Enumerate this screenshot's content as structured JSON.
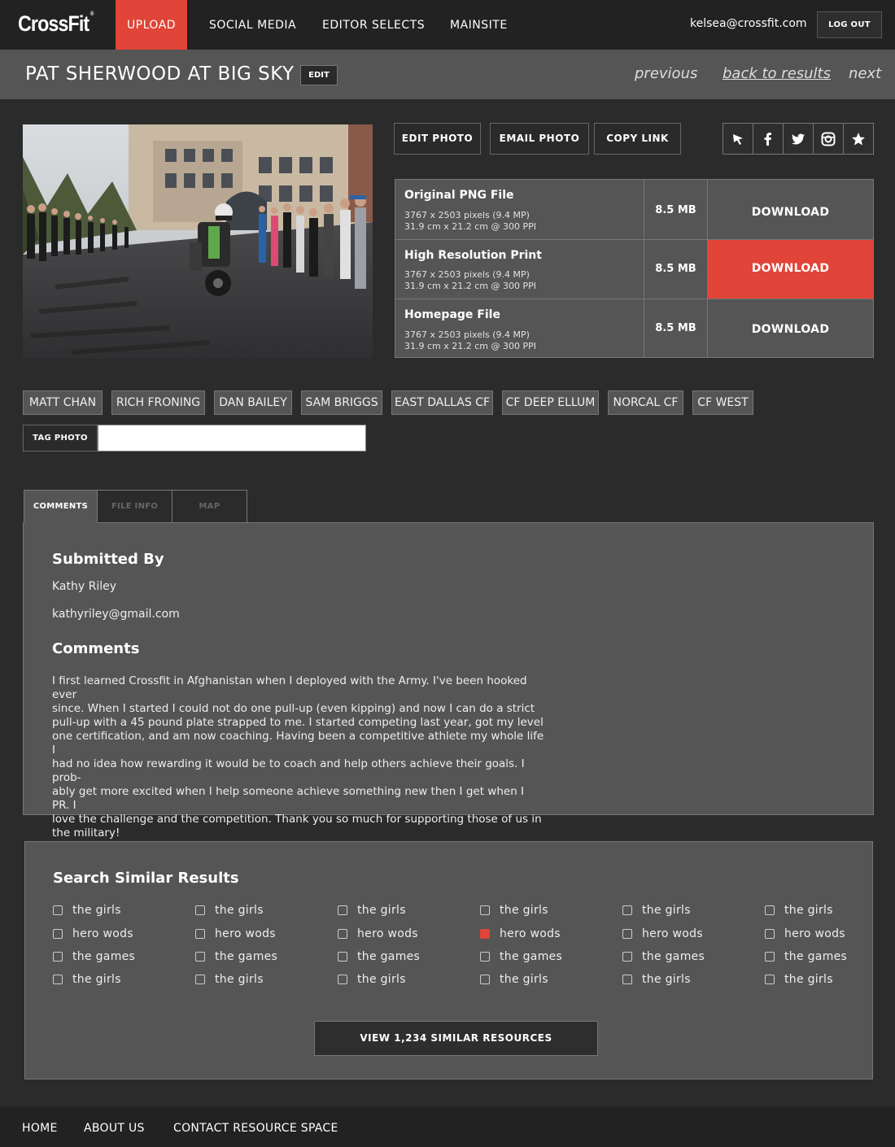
{
  "brand": {
    "logo_text": "CrossFit",
    "logo_mark": "®",
    "accent_color": "#e14438"
  },
  "nav": {
    "items": [
      {
        "label": "UPLOAD"
      },
      {
        "label": "SOCIAL MEDIA"
      },
      {
        "label": "EDITOR SELECTS"
      },
      {
        "label": "MAINSITE"
      }
    ],
    "user_email": "kelsea@crossfit.com",
    "logout_label": "LOG OUT"
  },
  "title_bar": {
    "title": "PAT SHERWOOD AT BIG SKY",
    "edit_label": "EDIT",
    "previous_label": "previous",
    "back_label": "back to results",
    "next_label": "next"
  },
  "actions": {
    "edit_photo": "EDIT PHOTO",
    "email_photo": "EMAIL PHOTO",
    "copy_link": "COPY LINK"
  },
  "share_icons": [
    "cursor-icon",
    "facebook-icon",
    "twitter-icon",
    "instagram-icon",
    "star-icon"
  ],
  "downloads": [
    {
      "name": "Original PNG File",
      "dims": "3767 x 2503 pixels (9.4 MP)",
      "print": "31.9 cm x 21.2 cm @ 300 PPI",
      "size": "8.5 MB",
      "button": "DOWNLOAD"
    },
    {
      "name": "High Resolution Print",
      "dims": "3767 x 2503 pixels (9.4 MP)",
      "print": "31.9 cm x 21.2 cm @ 300 PPI",
      "size": "8.5 MB",
      "button": "DOWNLOAD"
    },
    {
      "name": "Homepage File",
      "dims": "3767 x 2503 pixels (9.4 MP)",
      "print": "31.9 cm x 21.2 cm @ 300 PPI",
      "size": "8.5 MB",
      "button": "DOWNLOAD"
    }
  ],
  "tags": [
    "MATT CHAN",
    "RICH FRONING",
    "DAN BAILEY",
    "SAM BRIGGS",
    "EAST DALLAS CF",
    "CF DEEP ELLUM",
    "NORCAL CF",
    "CF WEST"
  ],
  "tag_photo": {
    "button": "TAG PHOTO",
    "input_value": ""
  },
  "tabs": [
    {
      "label": "COMMENTS"
    },
    {
      "label": "FILE INFO"
    },
    {
      "label": "MAP"
    }
  ],
  "comments_panel": {
    "submitted_heading": "Submitted By",
    "submitter_name": "Kathy Riley",
    "submitter_email": "kathyriley@gmail.com",
    "comments_heading": "Comments",
    "comment_lines": [
      "I first learned Crossfit in Afghanistan when I deployed with the Army.  I've been hooked ever",
      "since.  When I started I could not do one pull-up (even kipping) and now I can do a strict",
      "pull-up with a 45 pound plate strapped to me.  I started competing last year, got my level",
      "one certification, and am now coaching.  Having been a competitive athlete my whole life I",
      "had no idea how rewarding it would be to coach and help others achieve their goals.  I prob-",
      "ably get more excited when I help someone achieve something new then I get when I PR.  I",
      "love the challenge and the competition.  Thank you so much for supporting those of us in",
      "the military!"
    ]
  },
  "similar": {
    "title": "Search Similar Results",
    "columns": [
      [
        {
          "label": "the girls",
          "checked": false
        },
        {
          "label": "hero wods",
          "checked": false
        },
        {
          "label": "the games",
          "checked": false
        },
        {
          "label": "the girls",
          "checked": false
        }
      ],
      [
        {
          "label": "the girls",
          "checked": false
        },
        {
          "label": "hero wods",
          "checked": false
        },
        {
          "label": "the games",
          "checked": false
        },
        {
          "label": "the girls",
          "checked": false
        }
      ],
      [
        {
          "label": "the girls",
          "checked": false
        },
        {
          "label": "hero wods",
          "checked": false
        },
        {
          "label": "the games",
          "checked": false
        },
        {
          "label": "the girls",
          "checked": false
        }
      ],
      [
        {
          "label": "the girls",
          "checked": false
        },
        {
          "label": "hero wods",
          "checked": true
        },
        {
          "label": "the games",
          "checked": false
        },
        {
          "label": "the girls",
          "checked": false
        }
      ],
      [
        {
          "label": "the girls",
          "checked": false
        },
        {
          "label": "hero wods",
          "checked": false
        },
        {
          "label": "the games",
          "checked": false
        },
        {
          "label": "the girls",
          "checked": false
        }
      ],
      [
        {
          "label": "the girls",
          "checked": false
        },
        {
          "label": "hero wods",
          "checked": false
        },
        {
          "label": "the games",
          "checked": false
        },
        {
          "label": "the girls",
          "checked": false
        }
      ]
    ],
    "view_button": "VIEW 1,234 SIMILAR RESOURCES"
  },
  "footer": {
    "links": [
      "HOME",
      "ABOUT US",
      "CONTACT RESOURCE SPACE"
    ]
  }
}
